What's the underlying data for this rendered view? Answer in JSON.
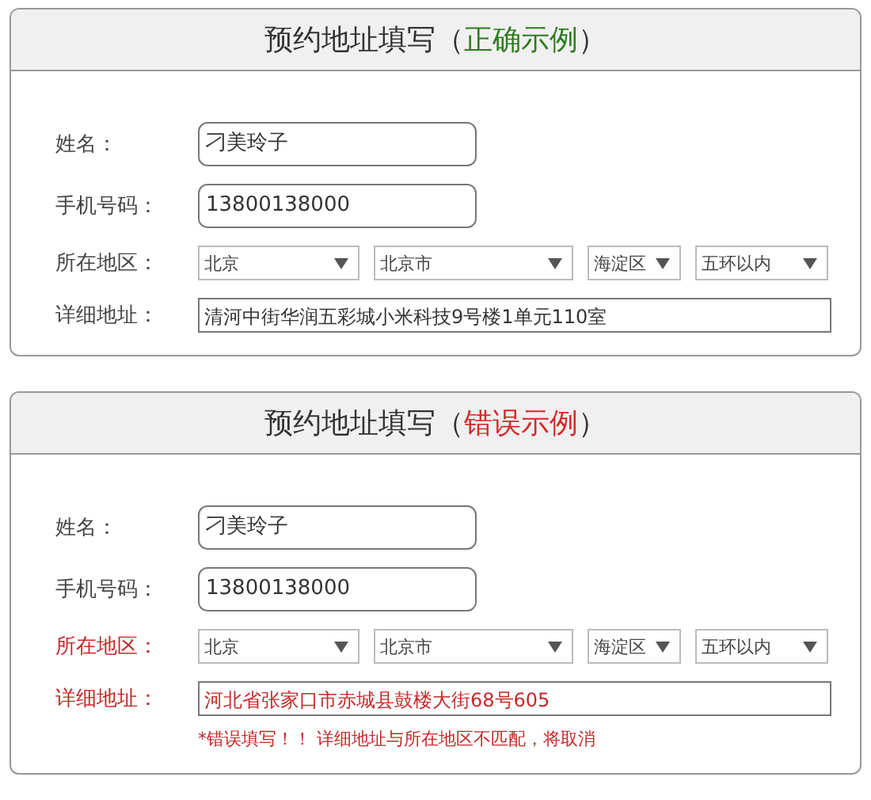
{
  "panels": [
    {
      "title": "预约地址填写（",
      "example": {
        "kind": "correct",
        "text": "正确示例"
      },
      "title_end": "）",
      "rows": [
        {
          "kind": "text",
          "label": "姓名：",
          "value": "刁美玲子",
          "invalid": false
        },
        {
          "kind": "text",
          "label": "手机号码：",
          "value": "13800138000",
          "invalid": false
        },
        {
          "kind": "selects",
          "label": "所在地区：",
          "invalid": false,
          "options": [
            "北京",
            "北京市",
            "海淀区",
            "五环以内"
          ]
        },
        {
          "kind": "address",
          "label": "详细地址：",
          "value": "清河中街华润五彩城小米科技9号楼1单元110室",
          "invalid": false
        }
      ]
    },
    {
      "title": "预约地址填写（",
      "example": {
        "kind": "wrong",
        "text": "错误示例"
      },
      "title_end": "）",
      "rows": [
        {
          "kind": "text",
          "label": "姓名：",
          "value": "刁美玲子",
          "invalid": false
        },
        {
          "kind": "text",
          "label": "手机号码：",
          "value": "13800138000",
          "invalid": false
        },
        {
          "kind": "selects",
          "label": "所在地区：",
          "invalid": true,
          "options": [
            "北京",
            "北京市",
            "海淀区",
            "五环以内"
          ]
        },
        {
          "kind": "address",
          "label": "详细地址：",
          "value": "河北省张家口市赤城县鼓楼大街68号605",
          "invalid": true
        }
      ],
      "error_message": "*错误填写！！ 详细地址与所在地区不匹配，将取消"
    }
  ]
}
